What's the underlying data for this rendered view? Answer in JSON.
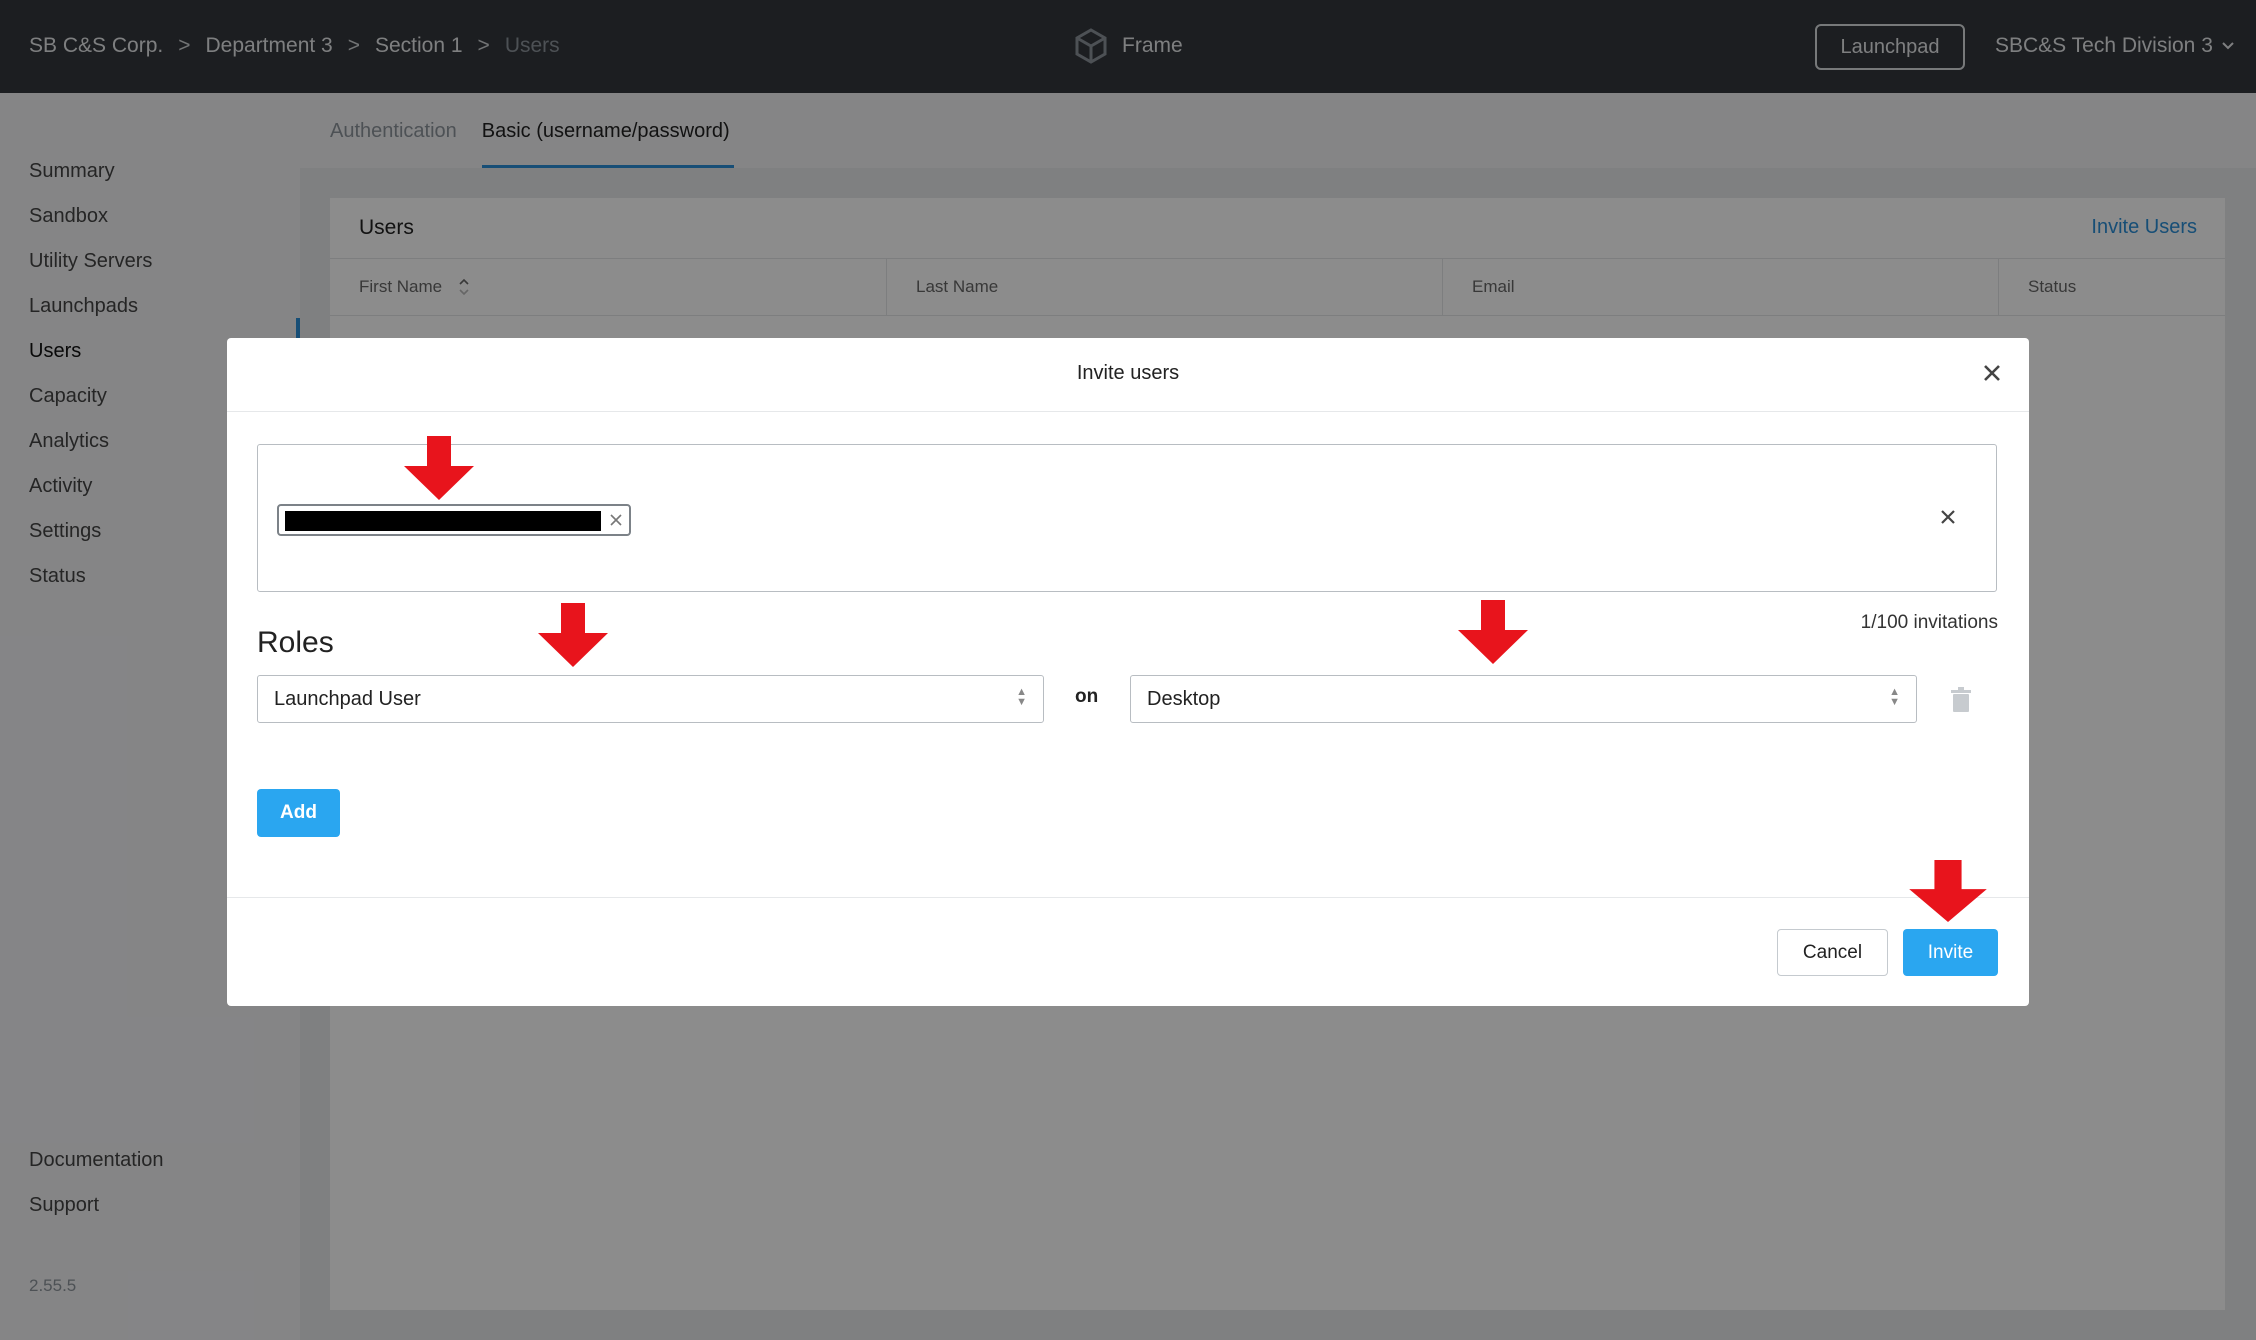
{
  "breadcrumb": {
    "items": [
      "SB C&S Corp.",
      "Department 3",
      "Section 1"
    ],
    "current": "Users",
    "separator": ">"
  },
  "brand": {
    "name": "Frame",
    "icon": "cube-icon"
  },
  "header": {
    "launchpad_button": "Launchpad",
    "org_name": "SBC&S Tech Division 3"
  },
  "sidebar": {
    "items": [
      {
        "label": "Summary"
      },
      {
        "label": "Sandbox"
      },
      {
        "label": "Utility Servers"
      },
      {
        "label": "Launchpads"
      },
      {
        "label": "Users",
        "active": true
      },
      {
        "label": "Capacity"
      },
      {
        "label": "Analytics"
      },
      {
        "label": "Activity"
      },
      {
        "label": "Settings"
      },
      {
        "label": "Status"
      }
    ],
    "footer": [
      "Documentation",
      "Support"
    ],
    "version": "2.55.5"
  },
  "tabs": [
    {
      "label": "Authentication",
      "active": false
    },
    {
      "label": "Basic (username/password)",
      "active": true
    }
  ],
  "users_card": {
    "title": "Users",
    "invite_link": "Invite Users",
    "columns": [
      "First Name",
      "Last Name",
      "Email",
      "Status"
    ]
  },
  "modal": {
    "title": "Invite users",
    "invitation_count": "1/100 invitations",
    "roles_label": "Roles",
    "role_value": "Launchpad User",
    "on_label": "on",
    "target_value": "Desktop",
    "add_label": "Add",
    "cancel_label": "Cancel",
    "invite_label": "Invite"
  },
  "colors": {
    "topbar": "#33373d",
    "accent": "#2aa6f0",
    "link": "#2a8fd8",
    "arrow": "#e8141c"
  }
}
